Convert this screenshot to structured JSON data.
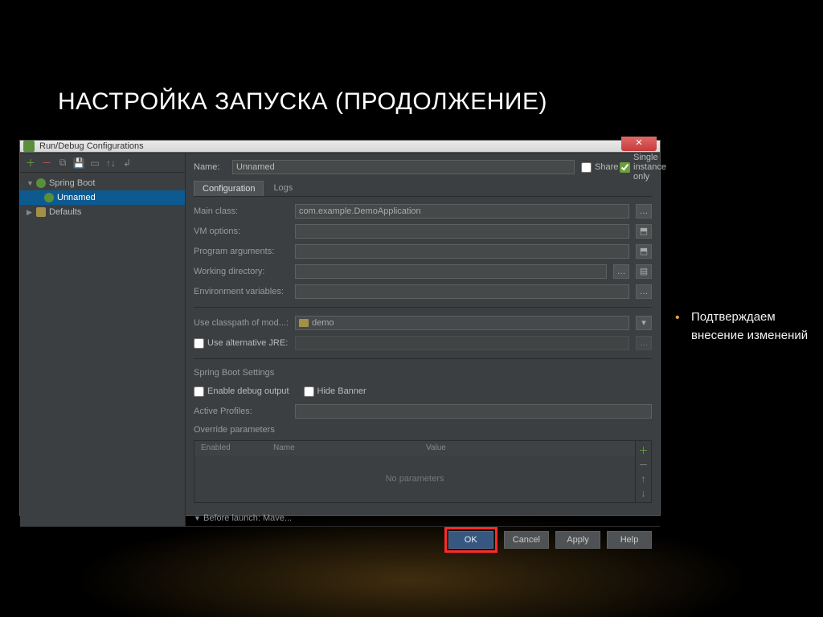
{
  "slide": {
    "title": "НАСТРОЙКА ЗАПУСКА (ПРОДОЛЖЕНИЕ)",
    "bullet": "Подтверждаем внесение изменений"
  },
  "dialog": {
    "title": "Run/Debug Configurations",
    "close_glyph": "✕",
    "name_label": "Name:",
    "name_value": "Unnamed",
    "share_label": "Share",
    "single_instance_label": "Single instance only",
    "tabs": {
      "configuration": "Configuration",
      "logs": "Logs"
    },
    "tree": {
      "root": "Spring Boot",
      "selected": "Unnamed",
      "defaults": "Defaults"
    },
    "fields": {
      "main_class_label": "Main class:",
      "main_class_value": "com.example.DemoApplication",
      "vm_options_label": "VM options:",
      "program_args_label": "Program arguments:",
      "working_dir_label": "Working directory:",
      "env_vars_label": "Environment variables:",
      "classpath_label": "Use classpath of mod...:",
      "classpath_value": "demo",
      "alt_jre_label": "Use alternative JRE:",
      "spring_settings_label": "Spring Boot Settings",
      "enable_debug_label": "Enable debug output",
      "hide_banner_label": "Hide Banner",
      "active_profiles_label": "Active Profiles:",
      "override_params_label": "Override parameters",
      "col_enabled": "Enabled",
      "col_name": "Name",
      "col_value": "Value",
      "no_params": "No parameters",
      "before_launch_label": "Before launch: Mave..."
    },
    "buttons": {
      "ok": "OK",
      "cancel": "Cancel",
      "apply": "Apply",
      "help": "Help"
    }
  }
}
